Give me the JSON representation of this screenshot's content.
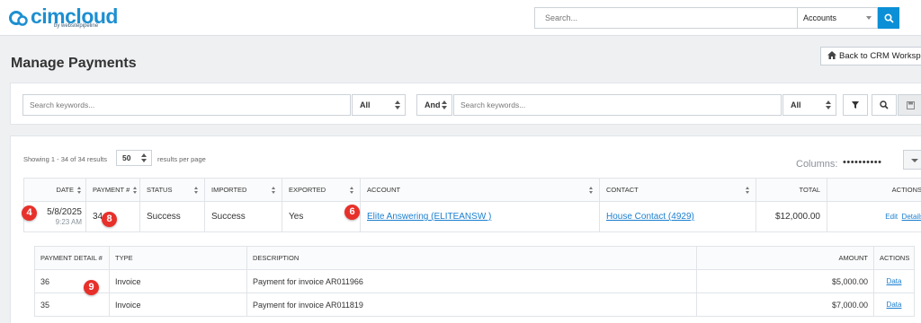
{
  "brand": {
    "name": "cimcloud",
    "tagline": "by websitepipeline"
  },
  "topbar": {
    "search_placeholder": "Search...",
    "search_scope": "Accounts"
  },
  "page": {
    "title": "Manage Payments",
    "back_label": "Back to CRM Workspace"
  },
  "filters": {
    "keyword1_placeholder": "Search keywords...",
    "field1": "All",
    "operator": "And",
    "keyword2_placeholder": "Search keywords...",
    "field2": "All"
  },
  "results": {
    "showing": "Showing 1 - 34 of 34 results",
    "per_page": "50",
    "per_page_label": "results per page",
    "columns_label": "Columns:",
    "columns_dots": "••••••••••"
  },
  "payments_table": {
    "headers": {
      "date": "DATE",
      "payment": "PAYMENT #",
      "status": "STATUS",
      "imported": "IMPORTED",
      "exported": "EXPORTED",
      "account": "ACCOUNT",
      "contact": "CONTACT",
      "total": "TOTAL",
      "actions": "ACTIONS"
    },
    "rows": [
      {
        "date": "5/8/2025",
        "time": "9:23 AM",
        "payment": "34",
        "status": "Success",
        "imported": "Success",
        "exported": "Yes",
        "account": "Elite Answering (ELITEANSW )",
        "contact": "House Contact (4929)",
        "total": "$12,000.00",
        "edit": "Edit",
        "details": "Details"
      }
    ]
  },
  "detail_table": {
    "headers": {
      "detail": "PAYMENT DETAIL #",
      "type": "TYPE",
      "description": "DESCRIPTION",
      "amount": "AMOUNT",
      "actions": "ACTIONS"
    },
    "rows": [
      {
        "detail": "36",
        "type": "Invoice",
        "description": "Payment for invoice AR011966",
        "amount": "$5,000.00",
        "action": "Data"
      },
      {
        "detail": "35",
        "type": "Invoice",
        "description": "Payment for invoice AR011819",
        "amount": "$7,000.00",
        "action": "Data"
      }
    ]
  },
  "annotations": {
    "a": "4",
    "b": "8",
    "c": "6",
    "d": "9"
  },
  "colors": {
    "accent": "#0b8fd6",
    "link": "#1a7fcf",
    "badge": "#e8302a"
  }
}
